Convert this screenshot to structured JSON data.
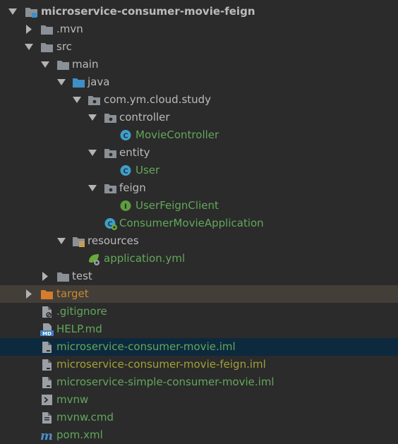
{
  "colors": {
    "background": "#2b2b2b",
    "text_default": "#bbbbbb",
    "text_git_added": "#62a85a",
    "text_excluded": "#c98a33",
    "text_git_untracked": "#a3a037",
    "target_row_bg": "#433e38",
    "selected_row_bg": "#0d293e",
    "folder_gray": "#8a9096",
    "folder_blue": "#3e8fc7",
    "folder_orange": "#d57c2e",
    "class_icon": "#3f9fc9",
    "interface_icon": "#5e9c3e"
  },
  "project_root": {
    "label": "microservice-consumer-movie-feign",
    "expanded": true,
    "icon": "module-folder-icon"
  },
  "tree": [
    {
      "label": ".mvn",
      "type": "folder",
      "icon": "folder-icon",
      "expanded": false
    },
    {
      "label": "src",
      "type": "folder",
      "icon": "folder-icon",
      "expanded": true
    },
    {
      "label": "main",
      "type": "folder",
      "icon": "folder-icon",
      "expanded": true
    },
    {
      "label": "java",
      "type": "folder",
      "icon": "source-folder-icon",
      "expanded": true
    },
    {
      "label": "com.ym.cloud.study",
      "type": "package",
      "icon": "package-icon",
      "expanded": true
    },
    {
      "label": "controller",
      "type": "package",
      "icon": "package-icon",
      "expanded": true
    },
    {
      "label": "MovieController",
      "type": "class",
      "icon": "class-icon",
      "status": "git-added"
    },
    {
      "label": "entity",
      "type": "package",
      "icon": "package-icon",
      "expanded": true
    },
    {
      "label": "User",
      "type": "class",
      "icon": "class-icon",
      "status": "git-added"
    },
    {
      "label": "feign",
      "type": "package",
      "icon": "package-icon",
      "expanded": true
    },
    {
      "label": "UserFeignClient",
      "type": "interface",
      "icon": "interface-icon",
      "status": "git-added"
    },
    {
      "label": "ConsumerMovieApplication",
      "type": "spring-boot-class",
      "icon": "spring-boot-class-icon",
      "status": "git-added"
    },
    {
      "label": "resources",
      "type": "folder",
      "icon": "resources-folder-icon",
      "expanded": true
    },
    {
      "label": "application.yml",
      "type": "file",
      "icon": "yml-file-icon",
      "status": "git-added"
    },
    {
      "label": "test",
      "type": "folder",
      "icon": "folder-icon",
      "expanded": false
    },
    {
      "label": "target",
      "type": "folder",
      "icon": "excluded-folder-icon",
      "expanded": false,
      "status": "excluded"
    },
    {
      "label": ".gitignore",
      "type": "file",
      "icon": "gitignore-file-icon",
      "status": "git-added"
    },
    {
      "label": "HELP.md",
      "type": "file",
      "icon": "markdown-file-icon",
      "status": "git-added"
    },
    {
      "label": "microservice-consumer-movie.iml",
      "type": "file",
      "icon": "iml-file-icon",
      "status": "git-added",
      "selected": true
    },
    {
      "label": "microservice-consumer-movie-feign.iml",
      "type": "file",
      "icon": "iml-file-icon",
      "status": "git-untracked"
    },
    {
      "label": "microservice-simple-consumer-movie.iml",
      "type": "file",
      "icon": "iml-file-icon",
      "status": "git-added"
    },
    {
      "label": "mvnw",
      "type": "file",
      "icon": "shell-file-icon",
      "status": "git-added"
    },
    {
      "label": "mvnw.cmd",
      "type": "file",
      "icon": "cmd-file-icon",
      "status": "git-added"
    },
    {
      "label": "pom.xml",
      "type": "file",
      "icon": "maven-pom-icon",
      "status": "git-added"
    }
  ]
}
